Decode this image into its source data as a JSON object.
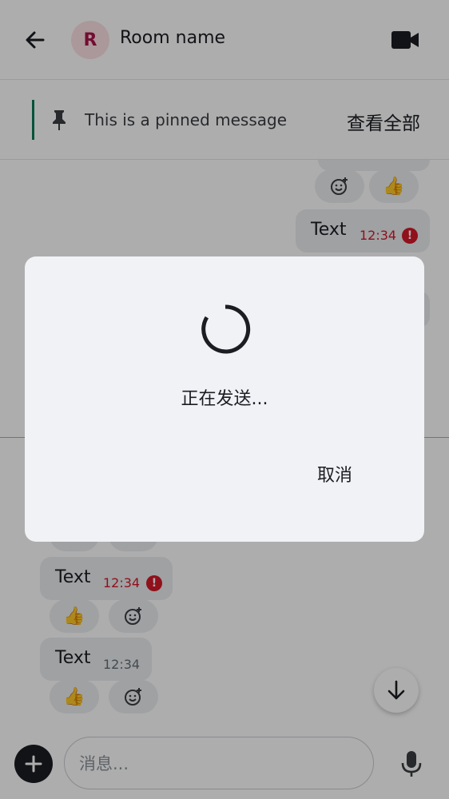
{
  "header": {
    "avatar_letter": "R",
    "room_name": "Room name"
  },
  "pinned": {
    "text": "This is a pinned message",
    "view_all": "查看全部"
  },
  "timeline": {
    "messages": [
      {
        "text": "Text",
        "time": "12:34",
        "failed": true
      },
      {
        "text": "Text",
        "time": "12:34",
        "failed": true
      },
      {
        "text": "Text",
        "time": "12:34",
        "failed": false
      }
    ],
    "reactions": [
      "👍"
    ]
  },
  "composer": {
    "placeholder": "消息..."
  },
  "dialog": {
    "message": "正在发送...",
    "cancel_label": "取消"
  },
  "colors": {
    "accent": "#0b7a57",
    "error": "#d51928",
    "avatar_bg": "#fde0e5",
    "avatar_fg": "#a8144a"
  },
  "icons": [
    "back-arrow-icon",
    "video-call-icon",
    "pin-icon",
    "add-reaction-icon",
    "thumbs-up-icon",
    "error-icon",
    "arrow-down-icon",
    "plus-icon",
    "microphone-icon",
    "loading-spinner-icon"
  ]
}
